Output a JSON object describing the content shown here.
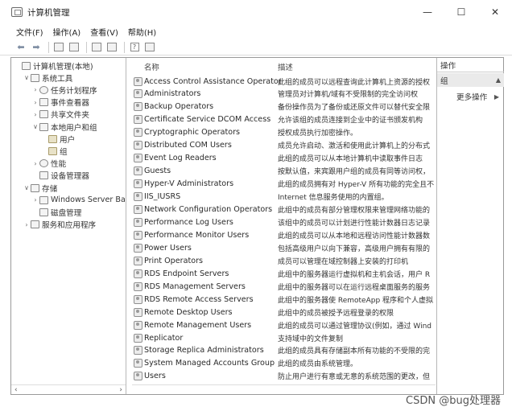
{
  "window": {
    "title": "计算机管理",
    "minimize": "—",
    "maximize": "☐",
    "close": "✕"
  },
  "menu": [
    "文件(F)",
    "操作(A)",
    "查看(V)",
    "帮助(H)"
  ],
  "tree": [
    {
      "label": "计算机管理(本地)",
      "level": 0,
      "twisty": "",
      "icon": "computer-icon"
    },
    {
      "label": "系统工具",
      "level": 1,
      "twisty": "∨",
      "icon": "tools-icon"
    },
    {
      "label": "任务计划程序",
      "level": 2,
      "twisty": "›",
      "icon": "clock-icon"
    },
    {
      "label": "事件查看器",
      "level": 2,
      "twisty": "›",
      "icon": "event-viewer-icon"
    },
    {
      "label": "共享文件夹",
      "level": 2,
      "twisty": "›",
      "icon": "shared-folder-icon"
    },
    {
      "label": "本地用户和组",
      "level": 2,
      "twisty": "∨",
      "icon": "users-icon"
    },
    {
      "label": "用户",
      "level": 3,
      "twisty": "",
      "icon": "folder-icon"
    },
    {
      "label": "组",
      "level": 3,
      "twisty": "",
      "icon": "folder-icon"
    },
    {
      "label": "性能",
      "level": 2,
      "twisty": "›",
      "icon": "performance-icon"
    },
    {
      "label": "设备管理器",
      "level": 2,
      "twisty": "",
      "icon": "device-manager-icon"
    },
    {
      "label": "存储",
      "level": 1,
      "twisty": "∨",
      "icon": "storage-icon"
    },
    {
      "label": "Windows Server Back",
      "level": 2,
      "twisty": "›",
      "icon": "backup-icon"
    },
    {
      "label": "磁盘管理",
      "level": 2,
      "twisty": "",
      "icon": "disk-icon"
    },
    {
      "label": "服务和应用程序",
      "level": 1,
      "twisty": "›",
      "icon": "services-icon"
    }
  ],
  "list": {
    "columns": {
      "name": "名称",
      "description": "描述"
    },
    "rows": [
      {
        "name": "Access Control Assistance Operators",
        "description": "此组的成员可以远程查询此计算机上资源的授权"
      },
      {
        "name": "Administrators",
        "description": "管理员对计算机/域有不受限制的完全访问权"
      },
      {
        "name": "Backup Operators",
        "description": "备份操作员为了备份或还原文件可以替代安全限"
      },
      {
        "name": "Certificate Service DCOM Access",
        "description": "允许该组的成员连接到企业中的证书颁发机构"
      },
      {
        "name": "Cryptographic Operators",
        "description": "授权成员执行加密操作。"
      },
      {
        "name": "Distributed COM Users",
        "description": "成员允许启动、激活和使用此计算机上的分布式"
      },
      {
        "name": "Event Log Readers",
        "description": "此组的成员可以从本地计算机中读取事件日志"
      },
      {
        "name": "Guests",
        "description": "按默认值，来宾跟用户组的成员有同等访问权，"
      },
      {
        "name": "Hyper-V Administrators",
        "description": "此组的成员拥有对 Hyper-V 所有功能的完全且不"
      },
      {
        "name": "IIS_IUSRS",
        "description": "Internet 信息服务使用的内置组。"
      },
      {
        "name": "Network Configuration Operators",
        "description": "此组中的成员有部分管理权限来管理网络功能的"
      },
      {
        "name": "Performance Log Users",
        "description": "该组中的成员可以计划进行性能计数器日志记录"
      },
      {
        "name": "Performance Monitor Users",
        "description": "此组的成员可以从本地和远程访问性能计数器数"
      },
      {
        "name": "Power Users",
        "description": "包括高级用户以向下兼容，高级用户拥有有限的"
      },
      {
        "name": "Print Operators",
        "description": "成员可以管理在域控制器上安装的打印机"
      },
      {
        "name": "RDS Endpoint Servers",
        "description": "此组中的服务器运行虚拟机和主机会话，用户 R"
      },
      {
        "name": "RDS Management Servers",
        "description": "此组中的服务器可以在运行远程桌面服务的服务"
      },
      {
        "name": "RDS Remote Access Servers",
        "description": "此组中的服务器使 RemoteApp 程序和个人虚拟"
      },
      {
        "name": "Remote Desktop Users",
        "description": "此组中的成员被授予远程登录的权限"
      },
      {
        "name": "Remote Management Users",
        "description": "此组的成员可以通过管理协议(例如，通过 Wind"
      },
      {
        "name": "Replicator",
        "description": "支持域中的文件复制"
      },
      {
        "name": "Storage Replica Administrators",
        "description": "此组的成员具有存储副本所有功能的不受限的完"
      },
      {
        "name": "System Managed Accounts Group",
        "description": "此组的成员由系统管理。"
      },
      {
        "name": "Users",
        "description": "防止用户进行有意或无意的系统范围的更改，但"
      }
    ]
  },
  "actions": {
    "header": "操作",
    "group": "组",
    "more": "更多操作"
  },
  "watermark": "CSDN @bug处理器"
}
